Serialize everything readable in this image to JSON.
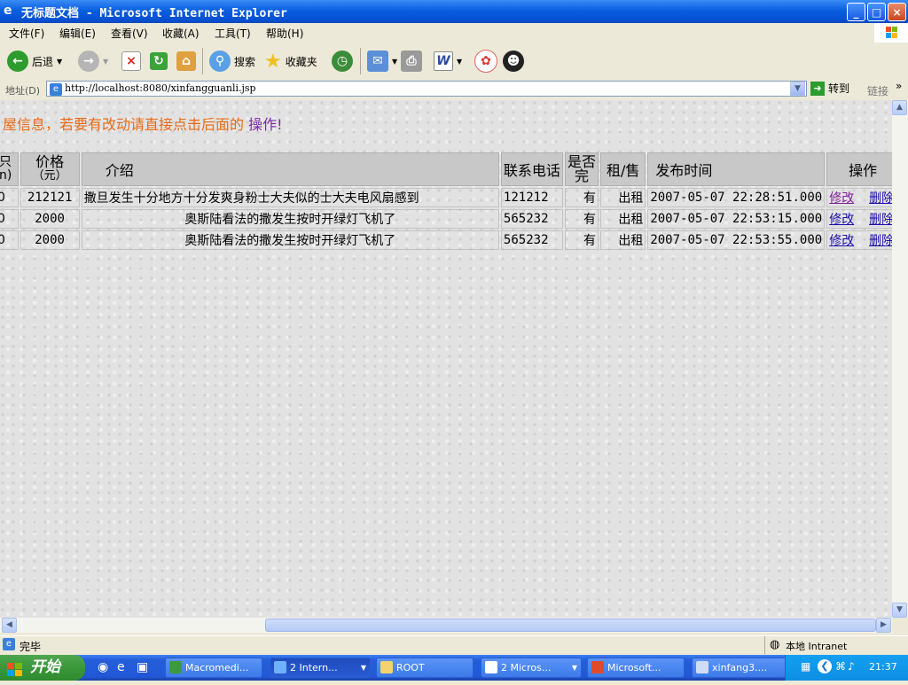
{
  "window": {
    "title": "无标题文档 - Microsoft Internet Explorer",
    "buttons": {
      "minimize": "_",
      "maximize": "□",
      "close": "×"
    }
  },
  "menu": [
    "文件(F)",
    "编辑(E)",
    "查看(V)",
    "收藏(A)",
    "工具(T)",
    "帮助(H)"
  ],
  "toolbar": {
    "back": "后退",
    "search": "搜索",
    "favorites": "收藏夹"
  },
  "address": {
    "label": "地址(D)",
    "url": "http://localhost:8080/xinfangguanli.jsp",
    "go": "转到",
    "links": "链接"
  },
  "page": {
    "notice": "屋信息，若要有改动请直接点击后面的",
    "notice_op": "操作!",
    "table": {
      "headers": [
        "积(m)",
        "价格（元）",
        "介绍",
        "联系电话",
        "是否完",
        "租/售",
        "发布时间",
        "操作"
      ],
      "area_head": [
        "只",
        "n)"
      ],
      "price_head": [
        "价格",
        "（元）"
      ],
      "complete_head": [
        "是否",
        "完"
      ],
      "rows": [
        {
          "area": "0",
          "price": "212121",
          "intro": "撒旦发生十分地方十分发爽身粉士大夫似的士大夫电风扇感到",
          "phone": "121212",
          "complete": "有",
          "type": "出租",
          "time": "2007-05-07 22:28:51.000",
          "edit": "修改",
          "delete": "删除"
        },
        {
          "area": "0",
          "price": "2000",
          "intro": "奥斯陆看法的撒发生按时开绿灯飞机了",
          "phone": "565232",
          "complete": "有",
          "type": "出租",
          "time": "2007-05-07 22:53:15.000",
          "edit": "修改",
          "delete": "删除"
        },
        {
          "area": "0",
          "price": "2000",
          "intro": "奥斯陆看法的撒发生按时开绿灯飞机了",
          "phone": "565232",
          "complete": "有",
          "type": "出租",
          "time": "2007-05-07 22:53:55.000",
          "edit": "修改",
          "delete": "删除"
        }
      ]
    }
  },
  "status": {
    "text": "完毕",
    "zone": "本地 Intranet"
  },
  "taskbar": {
    "start": "开始",
    "tasks": [
      "Macromedi...",
      "2 Intern...",
      "ROOT",
      "2 Micros...",
      "Microsoft...",
      "xinfang3...."
    ],
    "clock": "21:37"
  }
}
